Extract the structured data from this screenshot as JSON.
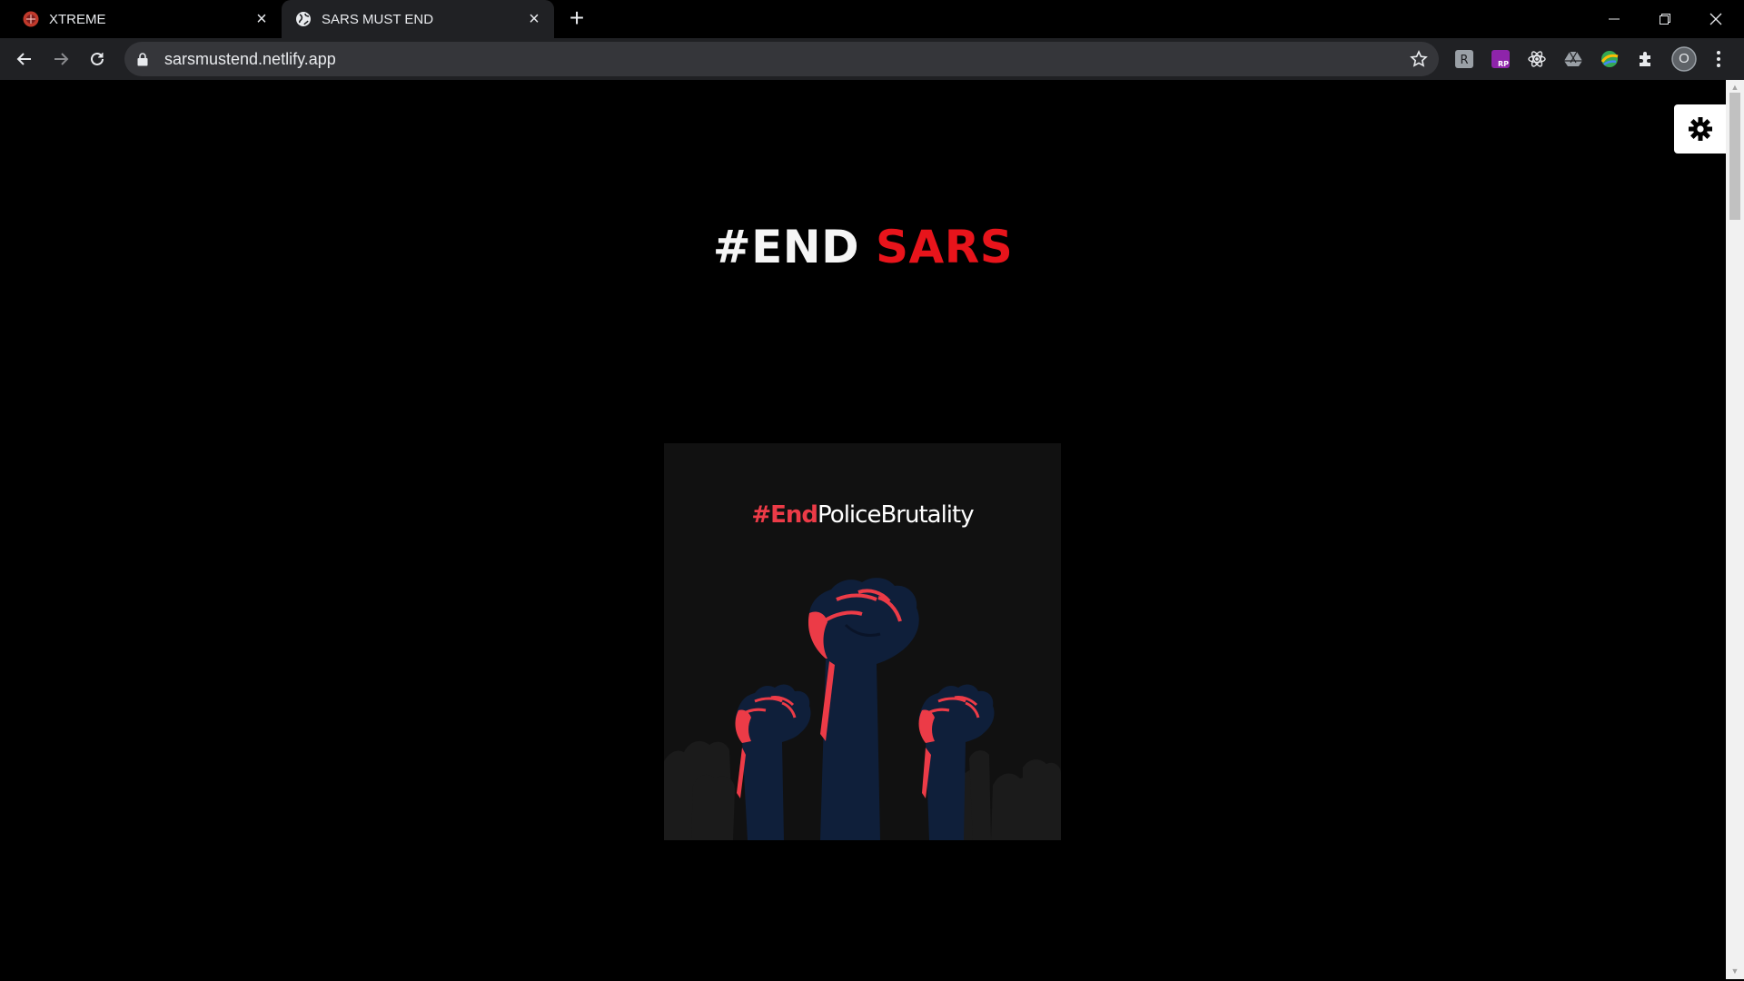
{
  "browser": {
    "tabs": [
      {
        "title": "XTREME",
        "active": false,
        "favicon": "xtreme-favicon-icon"
      },
      {
        "title": "SARS MUST END",
        "active": true,
        "favicon": "globe-icon"
      }
    ],
    "address": "sarsmustend.netlify.app",
    "toolbar_icons": [
      "back-arrow-icon",
      "forward-arrow-icon",
      "reload-icon",
      "lock-icon",
      "star-icon"
    ],
    "extensions": [
      "zoom-extension-icon",
      "rp-extension-icon",
      "react-devtools-icon",
      "drive-icon",
      "color-picker-extension-icon",
      "puzzle-extensions-icon"
    ],
    "profile_initial": "O",
    "window_controls": [
      "minimize-icon",
      "restore-icon",
      "close-window-icon"
    ]
  },
  "page": {
    "heading_part1": "#END",
    "heading_part2": "SARS",
    "poster": {
      "caption_red": "#End",
      "caption_white": "PoliceBrutality",
      "image": "raised-fists-illustration"
    },
    "settings_icon": "gear-icon"
  },
  "colors": {
    "accent_red": "#e8141b",
    "poster_red": "#ec3b47",
    "fist_navy": "#0f1f3a",
    "chrome_dark": "#202124"
  }
}
